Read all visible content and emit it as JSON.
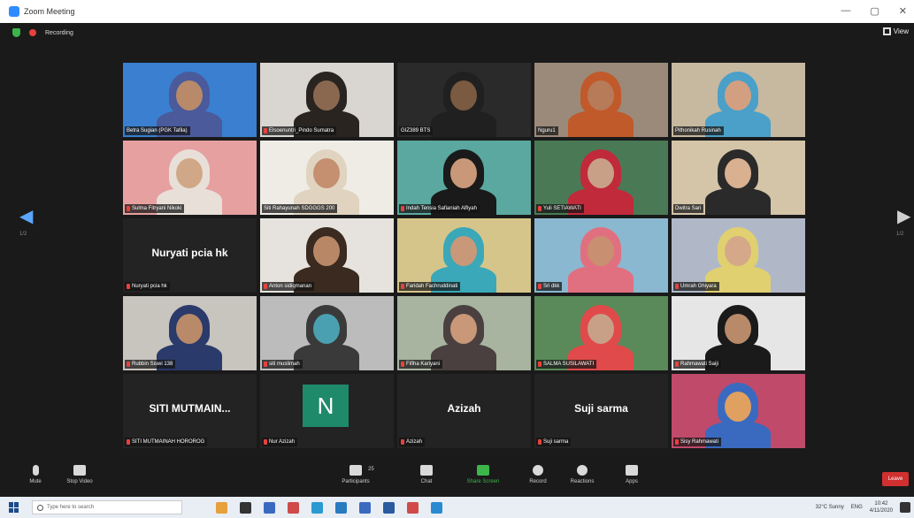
{
  "window": {
    "title": "Zoom Meeting",
    "controls": [
      "—",
      "▢",
      "✕"
    ]
  },
  "meeting_bar": {
    "recording_label": "Recording"
  },
  "view_button": {
    "label": "View"
  },
  "pagination": {
    "left_page": "1/2",
    "right_page": "1/2"
  },
  "participants": [
    {
      "name": "Betra Sugian (PGK Tafila)",
      "kind": "video",
      "bg": "#3a7fd0",
      "face": "#b88a6a",
      "hijab": "#4a5a9a",
      "muted": false,
      "active": false
    },
    {
      "name": "Elsoenuntri_Pindo Sumatra",
      "kind": "video",
      "bg": "#d9d6d2",
      "face": "#8a6850",
      "hijab": "#2a2420",
      "muted": true,
      "active": false
    },
    {
      "name": "GIZ389 BTS",
      "kind": "video",
      "bg": "#2a2a2a",
      "face": "#7a5a40",
      "hijab": "#202020",
      "muted": false,
      "active": false
    },
    {
      "name": "Nguru1",
      "kind": "video",
      "bg": "#9b8a7a",
      "face": "#b77b5a",
      "hijab": "#c05a2a",
      "muted": false,
      "active": false
    },
    {
      "name": "Pithonikah Rusinah",
      "kind": "video",
      "bg": "#c7b8a0",
      "face": "#d2a080",
      "hijab": "#4aa0c8",
      "muted": false,
      "active": true
    },
    {
      "name": "Sulma Fitryani Nikoki",
      "kind": "video",
      "bg": "#e6a0a0",
      "face": "#d0a888",
      "hijab": "#e8e0d8",
      "muted": true,
      "active": false
    },
    {
      "name": "Siti Rahayunah SDGGGS 200",
      "kind": "video",
      "bg": "#efece6",
      "face": "#c49070",
      "hijab": "#e0d4c0",
      "muted": false,
      "active": false
    },
    {
      "name": "Indah Tensia Safianiah Alfiyah",
      "kind": "video",
      "bg": "#5aa8a0",
      "face": "#c89878",
      "hijab": "#1a1a1a",
      "muted": true,
      "active": false
    },
    {
      "name": "Yuli SETIAWATI",
      "kind": "video",
      "bg": "#4a7a55",
      "face": "#c8a088",
      "hijab": "#c02a3a",
      "muted": true,
      "active": false
    },
    {
      "name": "Dwitra Sari",
      "kind": "video",
      "bg": "#d4c4a8",
      "face": "#d9b090",
      "hijab": "#2a2a2a",
      "muted": false,
      "active": false
    },
    {
      "name": "Nuryati pcia hk",
      "kind": "name",
      "display": "Nuryati pcia hk",
      "muted": true,
      "active": false
    },
    {
      "name": "Anton sidiqmanan",
      "kind": "video",
      "bg": "#e6e3de",
      "face": "#b88866",
      "hijab": "#3a2a20",
      "muted": true,
      "active": false
    },
    {
      "name": "Faridah Fachruddinati",
      "kind": "video",
      "bg": "#d6c58a",
      "face": "#c89878",
      "hijab": "#3aa8b8",
      "muted": true,
      "active": false
    },
    {
      "name": "Sri dkk",
      "kind": "video",
      "bg": "#8ab8d0",
      "face": "#c89070",
      "hijab": "#e07080",
      "muted": true,
      "active": false
    },
    {
      "name": "Umrah Ghiyara",
      "kind": "video",
      "bg": "#b0b8c8",
      "face": "#d4a888",
      "hijab": "#e0d070",
      "muted": true,
      "active": false
    },
    {
      "name": "Rubbin Siswi 138",
      "kind": "video",
      "bg": "#c8c4be",
      "face": "#b88a6a",
      "hijab": "#2a3a6a",
      "muted": true,
      "active": false
    },
    {
      "name": "siti muslimah",
      "kind": "video",
      "bg": "#bcbcbc",
      "face": "#4aa0b0",
      "hijab": "#3a3a3a",
      "muted": true,
      "active": false
    },
    {
      "name": "Fifiha Kariyani",
      "kind": "video",
      "bg": "#a8b4a0",
      "face": "#c89878",
      "hijab": "#4a4040",
      "muted": true,
      "active": false
    },
    {
      "name": "SALMA SUSILAWATI",
      "kind": "video",
      "bg": "#5a8a5a",
      "face": "#c8a088",
      "hijab": "#e04a4a",
      "muted": true,
      "active": false
    },
    {
      "name": "Rahmawati Saiji",
      "kind": "video",
      "bg": "#e6e6e6",
      "face": "#b88a6a",
      "hijab": "#1a1a1a",
      "muted": true,
      "active": false
    },
    {
      "name": "SITI MUTMAINAH HOROROG",
      "kind": "name",
      "display": "SITI MUTMAIN...",
      "muted": true,
      "active": false
    },
    {
      "name": "Nur Azizah",
      "kind": "avatar",
      "display": "N",
      "muted": true,
      "active": false
    },
    {
      "name": "Azizah",
      "kind": "name",
      "display": "Azizah",
      "muted": true,
      "active": false
    },
    {
      "name": "Suji sarma",
      "kind": "name",
      "display": "Suji sarma",
      "muted": true,
      "active": false
    },
    {
      "name": "Sisy Rahmawati",
      "kind": "video",
      "bg": "#c04a6a",
      "face": "#e0a060",
      "hijab": "#3a6ac0",
      "muted": true,
      "active": false
    }
  ],
  "toolbar": {
    "unmute": "Mute",
    "video": "Stop Video",
    "participants": "Participants",
    "participants_count": "25",
    "chat": "Chat",
    "share": "Share Screen",
    "record": "Record",
    "reactions": "Reactions",
    "apps": "Apps",
    "leave": "Leave"
  },
  "taskbar": {
    "search_placeholder": "Type here to search",
    "app_colors": [
      "#e8a03a",
      "#333333",
      "#3a6ac0",
      "#d04a4a",
      "#2a9ad0",
      "#2a7ac0",
      "#3a6ac0",
      "#2a5aa0",
      "#d04a4a",
      "#2a8ad0"
    ],
    "weather": "32°C Sunny",
    "lang": "ENG",
    "time": "10:42",
    "date": "4/11/2020"
  }
}
